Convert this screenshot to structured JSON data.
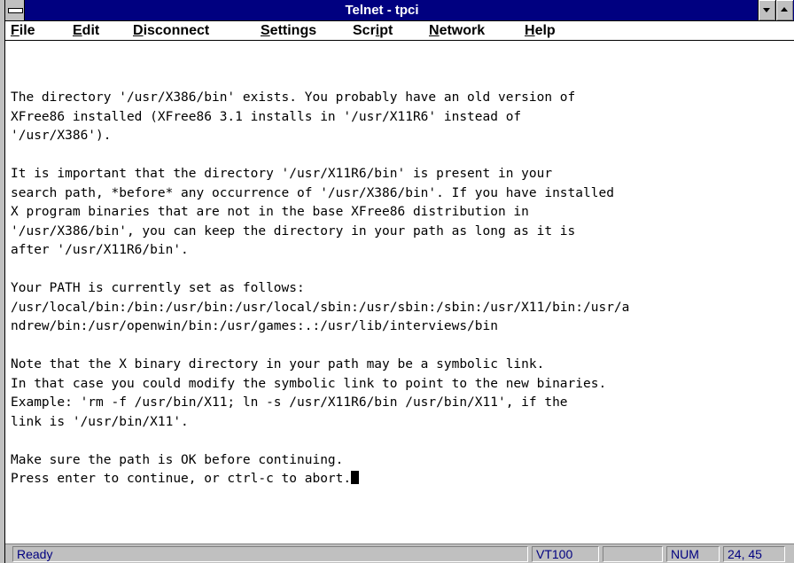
{
  "window": {
    "title": "Telnet - tpci"
  },
  "menu": {
    "items": [
      {
        "label": "File",
        "key": "F",
        "rest": "ile"
      },
      {
        "label": "Edit",
        "key": "E",
        "rest": "dit"
      },
      {
        "label": "Disconnect",
        "key": "D",
        "rest": "isconnect"
      },
      {
        "label": "Settings",
        "key": "S",
        "rest": "ettings"
      },
      {
        "label": "Script",
        "key": "S",
        "pre": "",
        "rest": "cript",
        "underline_index": 3
      },
      {
        "label": "Network",
        "key": "N",
        "rest": "etwork"
      },
      {
        "label": "Help",
        "key": "H",
        "rest": "elp"
      }
    ]
  },
  "terminal": {
    "lines": [
      "The directory '/usr/X386/bin' exists. You probably have an old version of",
      "XFree86 installed (XFree86 3.1 installs in '/usr/X11R6' instead of",
      "'/usr/X386').",
      "",
      "It is important that the directory '/usr/X11R6/bin' is present in your",
      "search path, *before* any occurrence of '/usr/X386/bin'. If you have installed",
      "X program binaries that are not in the base XFree86 distribution in",
      "'/usr/X386/bin', you can keep the directory in your path as long as it is",
      "after '/usr/X11R6/bin'.",
      "",
      "Your PATH is currently set as follows:",
      "/usr/local/bin:/bin:/usr/bin:/usr/local/sbin:/usr/sbin:/sbin:/usr/X11/bin:/usr/a",
      "ndrew/bin:/usr/openwin/bin:/usr/games:.:/usr/lib/interviews/bin",
      "",
      "Note that the X binary directory in your path may be a symbolic link.",
      "In that case you could modify the symbolic link to point to the new binaries.",
      "Example: 'rm -f /usr/bin/X11; ln -s /usr/X11R6/bin /usr/bin/X11', if the",
      "link is '/usr/bin/X11'.",
      "",
      "Make sure the path is OK before continuing.",
      "Press enter to continue, or ctrl-c to abort."
    ]
  },
  "status": {
    "message": "Ready",
    "emulation": "VT100",
    "num": "NUM",
    "position": "24, 45"
  },
  "colors": {
    "titlebar": "#000080",
    "status_text": "#000080",
    "chrome": "#c0c0c0"
  }
}
